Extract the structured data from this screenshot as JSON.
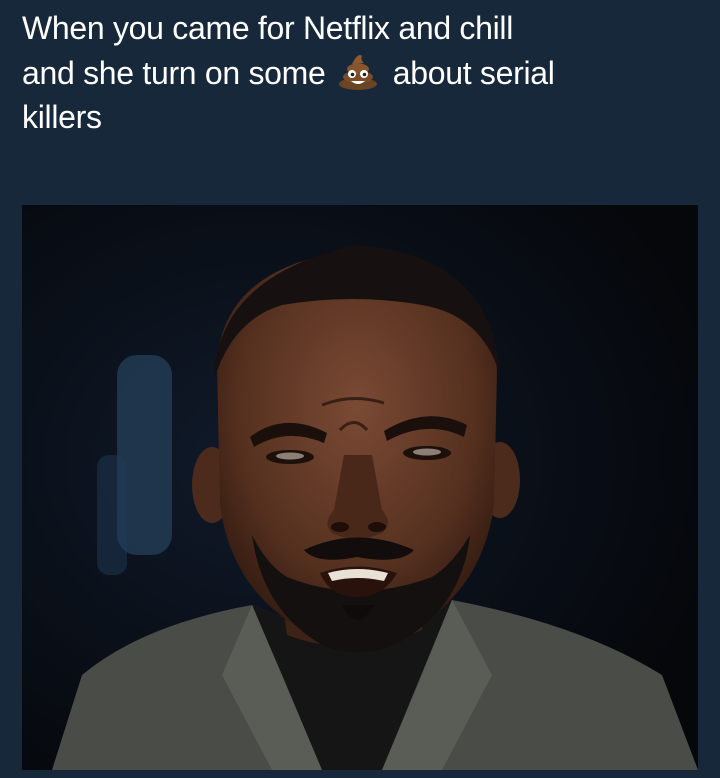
{
  "caption": {
    "line1": "When you came for Netflix and chill",
    "line2_before": "and she turn on some ",
    "line2_after": " about serial",
    "line3": "killers",
    "emoji_icon": "pile-of-poo-emoji"
  },
  "photo": {
    "subject": "man-frowning-reaction-photo"
  },
  "colors": {
    "background": "#17283a",
    "text": "#ffffff"
  }
}
